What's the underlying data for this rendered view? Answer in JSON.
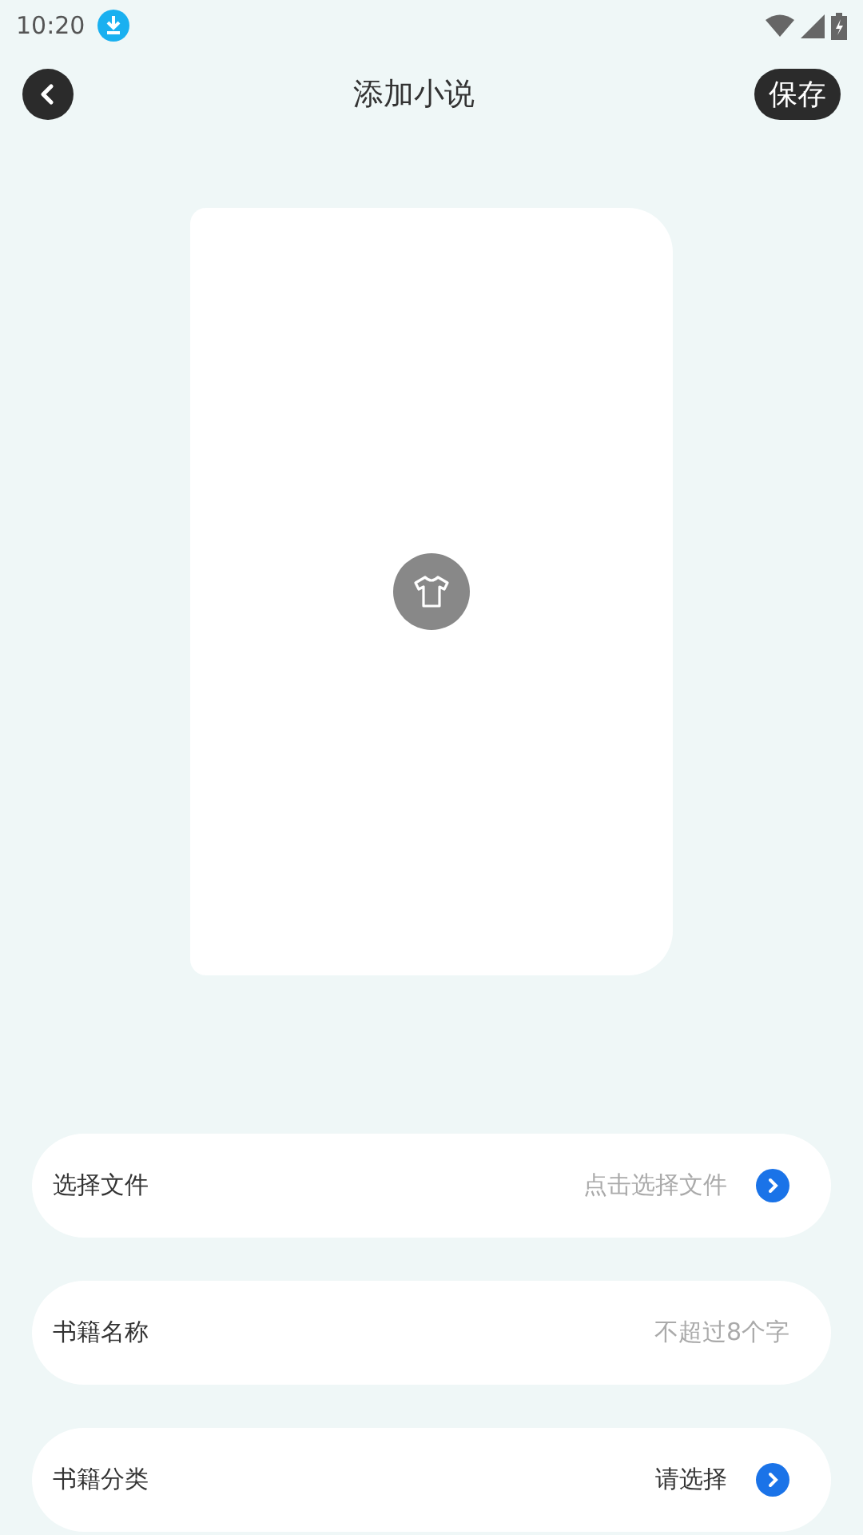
{
  "status_bar": {
    "time": "10:20"
  },
  "header": {
    "title": "添加小说",
    "save": "保存"
  },
  "rows": [
    {
      "kind": "select",
      "label": "选择文件",
      "value": "点击选择文件",
      "muted": true
    },
    {
      "kind": "input",
      "label": "书籍名称",
      "placeholder": "不超过8个字"
    },
    {
      "kind": "select",
      "label": "书籍分类",
      "value": "请选择",
      "muted": false
    }
  ]
}
